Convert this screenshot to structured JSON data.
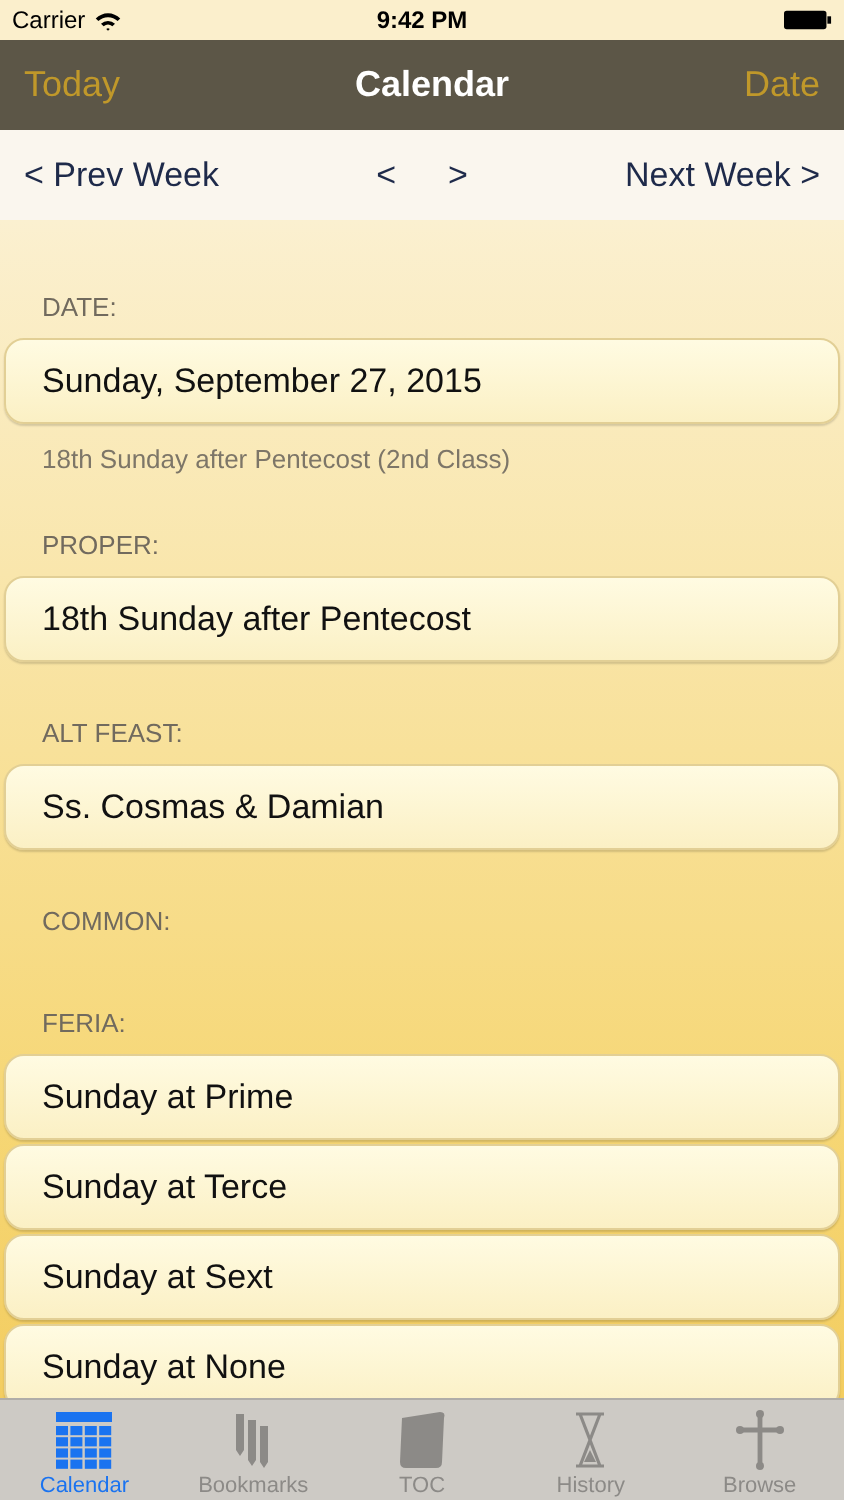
{
  "status_bar": {
    "carrier": "Carrier",
    "time": "9:42 PM"
  },
  "nav_bar": {
    "left": "Today",
    "title": "Calendar",
    "right": "Date"
  },
  "week_bar": {
    "prev_week": "< Prev Week",
    "prev": "<",
    "next": ">",
    "next_week": "Next Week >"
  },
  "sections": [
    {
      "label": "DATE:",
      "rows": [
        "Sunday, September 27, 2015"
      ],
      "note": "18th Sunday after Pentecost (2nd Class)"
    },
    {
      "label": "PROPER:",
      "rows": [
        "18th Sunday after Pentecost"
      ]
    },
    {
      "label": "ALT FEAST:",
      "rows": [
        "Ss. Cosmas & Damian"
      ]
    },
    {
      "label": "COMMON:"
    },
    {
      "label": "FERIA:",
      "rows": [
        "Sunday at Prime",
        "Sunday at Terce",
        "Sunday at Sext",
        "Sunday at None"
      ]
    }
  ],
  "tab_bar": [
    {
      "label": "Calendar",
      "selected": true
    },
    {
      "label": "Bookmarks",
      "selected": false
    },
    {
      "label": "TOC",
      "selected": false
    },
    {
      "label": "History",
      "selected": false
    },
    {
      "label": "Browse",
      "selected": false
    }
  ]
}
